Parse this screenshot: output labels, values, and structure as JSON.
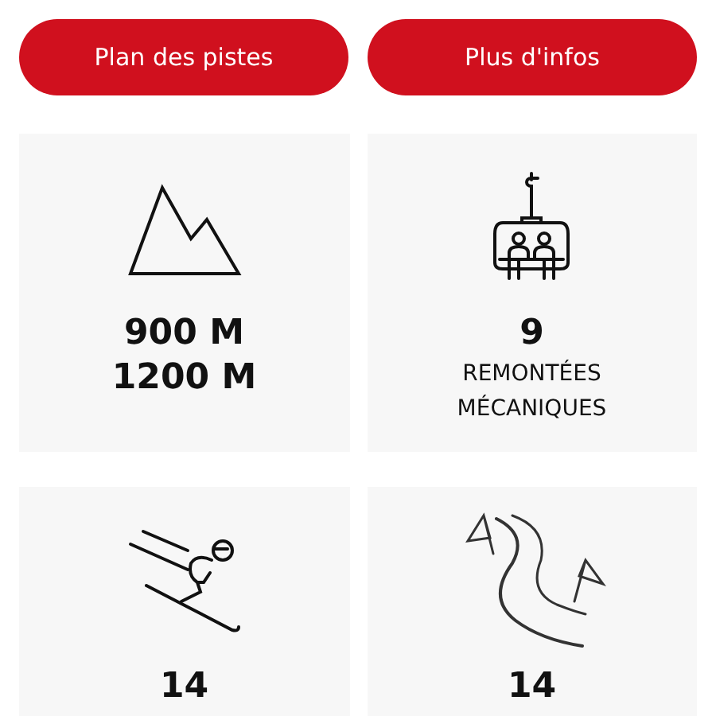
{
  "buttons": [
    {
      "label": "Plan des pistes"
    },
    {
      "label": "Plus d'infos"
    }
  ],
  "cards": [
    {
      "kind": "mountain",
      "values": [
        "900 M",
        "1200 M"
      ]
    },
    {
      "kind": "chairlift",
      "values": [
        "9"
      ],
      "labels": [
        "REMONTÉES",
        "MÉCANIQUES"
      ]
    },
    {
      "kind": "skier",
      "values": [
        "14"
      ]
    },
    {
      "kind": "slope",
      "values": [
        "14"
      ]
    }
  ]
}
